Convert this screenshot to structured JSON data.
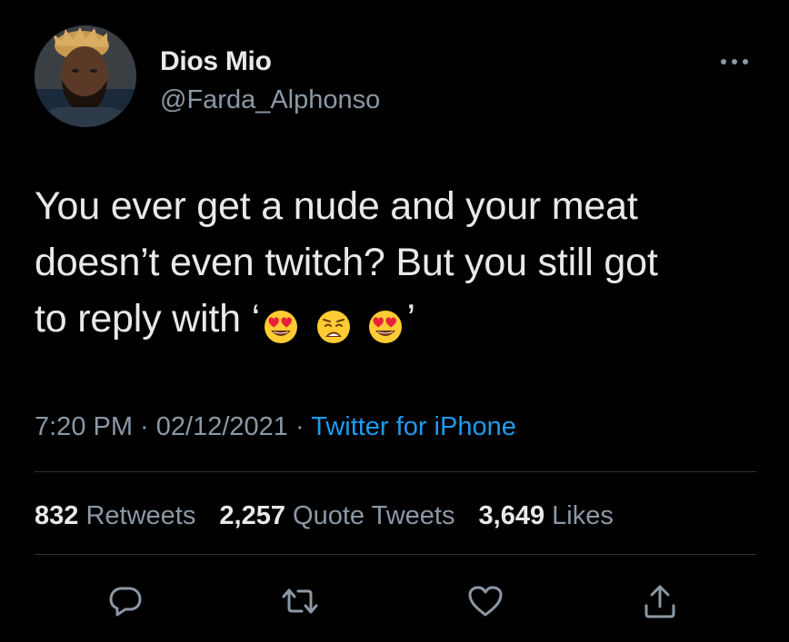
{
  "author": {
    "display_name": "Dios Mio",
    "handle": "@Farda_Alphonso",
    "avatar_icon": "profile-photo"
  },
  "tweet": {
    "text_line_1": "You ever get a nude and your meat",
    "text_line_2": "doesn’t even twitch? But you still got",
    "text_line_3": "to reply with ‘",
    "text_end": "’",
    "emojis": [
      "heart-eyes-emoji",
      "weary-face-emoji",
      "heart-eyes-emoji"
    ]
  },
  "meta": {
    "time": "7:20 PM",
    "sep1": " · ",
    "date": "02/12/2021",
    "sep2": " · ",
    "source": "Twitter for iPhone"
  },
  "stats": {
    "retweets_count": "832",
    "retweets_label": "Retweets",
    "quotes_count": "2,257",
    "quotes_label": "Quote Tweets",
    "likes_count": "3,649",
    "likes_label": "Likes"
  },
  "colors": {
    "background": "#000000",
    "text_primary": "#e7e9ea",
    "text_secondary": "#8b98a5",
    "link": "#1d9bf0",
    "divider": "#2f3336"
  },
  "icons": {
    "more": "more-horizontal-icon",
    "reply": "reply-icon",
    "retweet": "retweet-icon",
    "like": "like-heart-icon",
    "share": "share-icon"
  }
}
